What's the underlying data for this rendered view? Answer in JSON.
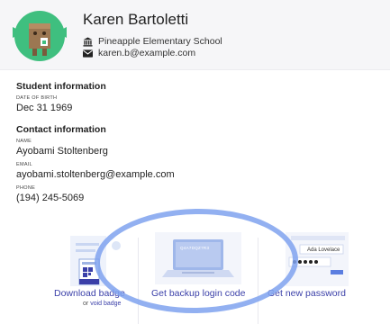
{
  "profile": {
    "name": "Karen Bartoletti",
    "school": "Pineapple Elementary School",
    "email": "karen.b@example.com"
  },
  "student_info": {
    "title": "Student information",
    "dob_label": "DATE OF BIRTH",
    "dob_value": "Dec 31 1969"
  },
  "contact_info": {
    "title": "Contact information",
    "name_label": "NAME",
    "name_value": "Ayobami Stoltenberg",
    "email_label": "EMAIL",
    "email_value": "ayobami.stoltenberg@example.com",
    "phone_label": "PHONE",
    "phone_value": "(194) 245-5069"
  },
  "actions": {
    "download_badge": "Download badge",
    "or_text": "or",
    "void_badge": "void badge",
    "backup_code": "Get backup login code",
    "laptop_screen_code": "Q4A7DQZ7R3",
    "new_password": "Get new password",
    "password_example_name": "Ada Lovelace"
  },
  "colors": {
    "accent": "#3a3fa8",
    "highlight": "#7fa2ef",
    "avatar_bg": "#3fbf7f"
  },
  "icons": {
    "school": "bank-icon",
    "email": "envelope-icon"
  }
}
